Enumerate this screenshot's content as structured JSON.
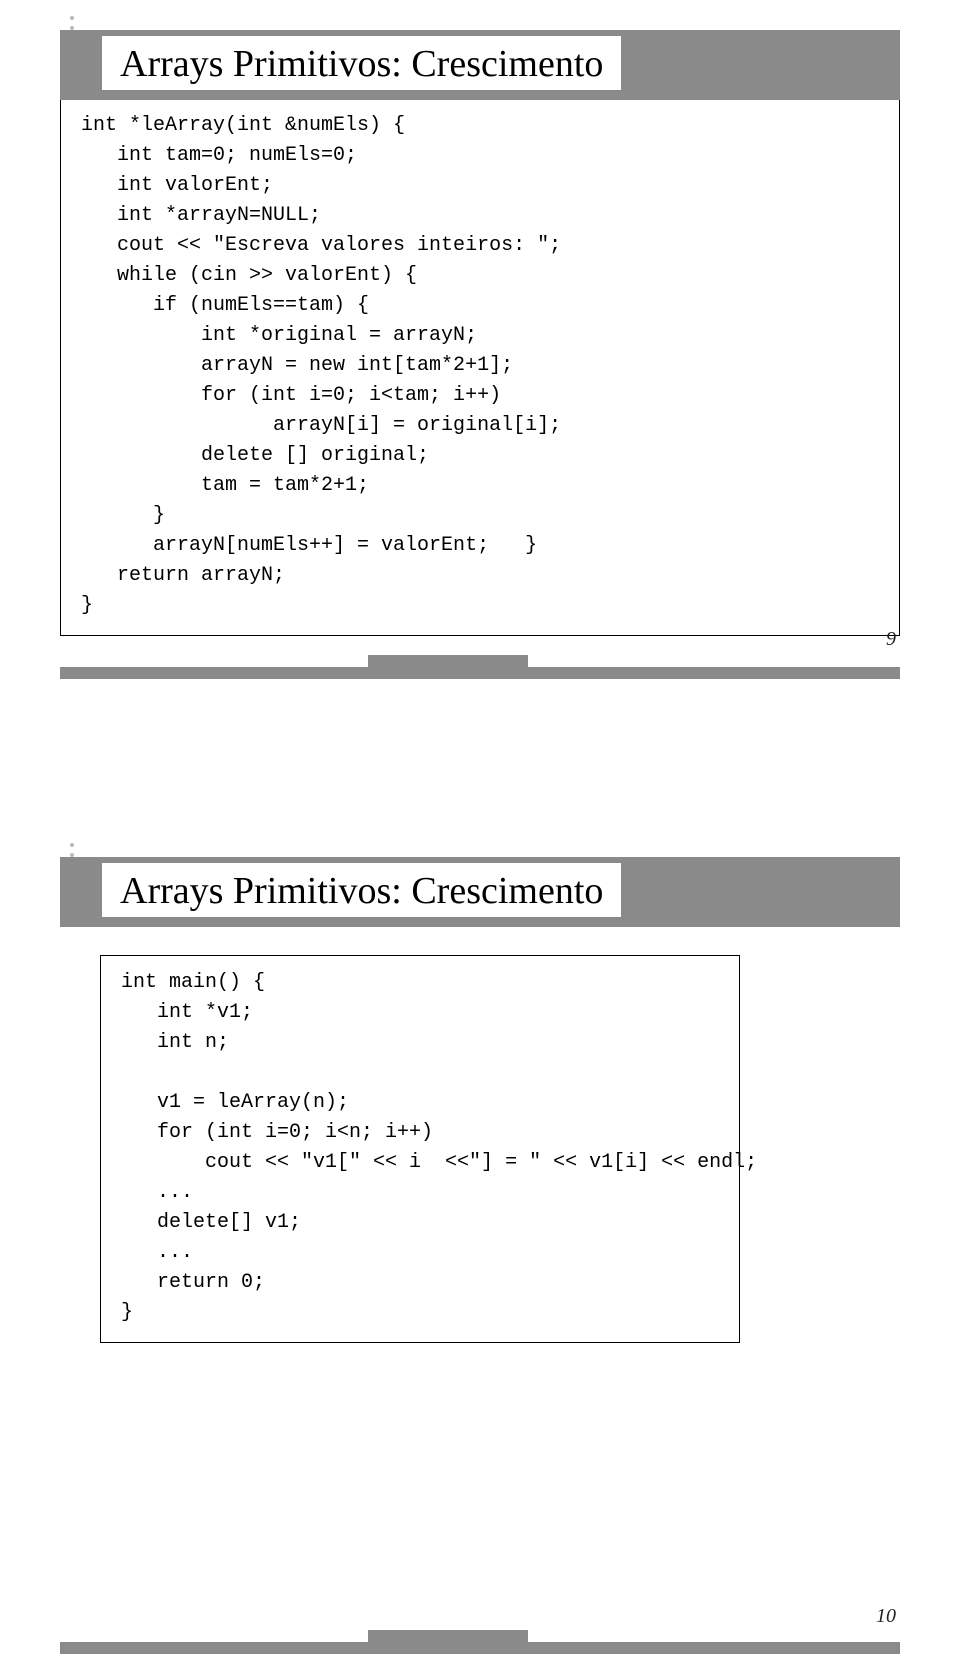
{
  "slide1": {
    "title": "Arrays Primitivos: Crescimento",
    "code": "int *leArray(int &numEls) {\n   int tam=0; numEls=0;\n   int valorEnt;\n   int *arrayN=NULL;\n   cout << \"Escreva valores inteiros: \";\n   while (cin >> valorEnt) {\n      if (numEls==tam) {\n          int *original = arrayN;\n          arrayN = new int[tam*2+1];\n          for (int i=0; i<tam; i++)\n                arrayN[i] = original[i];\n          delete [] original;\n          tam = tam*2+1;\n      }\n      arrayN[numEls++] = valorEnt;   }\n   return arrayN;\n}",
    "pagenum": "9"
  },
  "slide2": {
    "title": "Arrays Primitivos: Crescimento",
    "code": "int main() {\n   int *v1;\n   int n;\n\n   v1 = leArray(n);\n   for (int i=0; i<n; i++)\n       cout << \"v1[\" << i  <<\"] = \" << v1[i] << endl;\n   ...\n   delete[] v1;\n   ...\n   return 0;\n}",
    "pagenum": "10"
  }
}
